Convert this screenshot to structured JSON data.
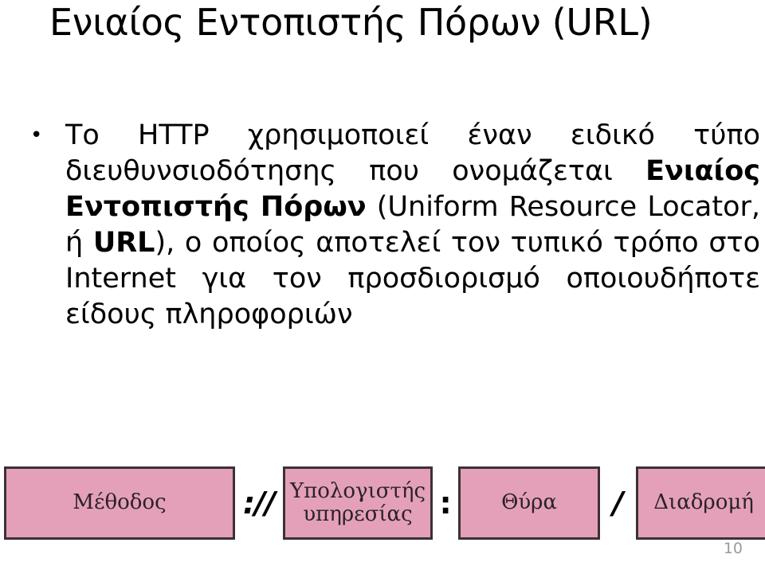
{
  "slide": {
    "title": "Ενιαίος Εντοπιστής Πόρων (URL)",
    "page_number": "10",
    "bullet_marker": "•",
    "body": {
      "segments": [
        {
          "text": "Το HTTP χρησιμοποιεί έναν ειδικό τύπο διευθυνσιοδότησης που ονομάζεται ",
          "bold": false
        },
        {
          "text": "Ενιαίος Εντοπιστής Πόρων",
          "bold": true
        },
        {
          "text": " (Uniform Resource Locator, ή ",
          "bold": false
        },
        {
          "text": "URL",
          "bold": true
        },
        {
          "text": "), ο οποίος αποτελεί τον τυπικό τρόπο στο Internet για τον προσδιορισμό οποιουδήποτε είδους πληροφοριών",
          "bold": false
        }
      ],
      "plain_text": "Το HTTP χρησιμοποιεί έναν ειδικό τύπο διευθυνσιοδότησης που ονομάζεται Ενιαίος Εντοπιστής Πόρων (Uniform Resource Locator, ή URL), ο οποίος αποτελεί τον τυπικό τρόπο στο Internet για τον προσδιορισμό οποιουδήποτε είδους πληροφοριών"
    },
    "url_diagram": {
      "box_fill_color": "#e4a0b9",
      "box_border_color": "#3b3138",
      "parts": [
        {
          "type": "box",
          "label": "Μέθοδος"
        },
        {
          "type": "separator",
          "label": "://"
        },
        {
          "type": "box",
          "label": "Υπολογιστής υπηρεσίας"
        },
        {
          "type": "separator",
          "label": ":"
        },
        {
          "type": "box",
          "label": "Θύρα"
        },
        {
          "type": "separator",
          "label": "/"
        },
        {
          "type": "box",
          "label": "Διαδρομή"
        }
      ]
    }
  }
}
